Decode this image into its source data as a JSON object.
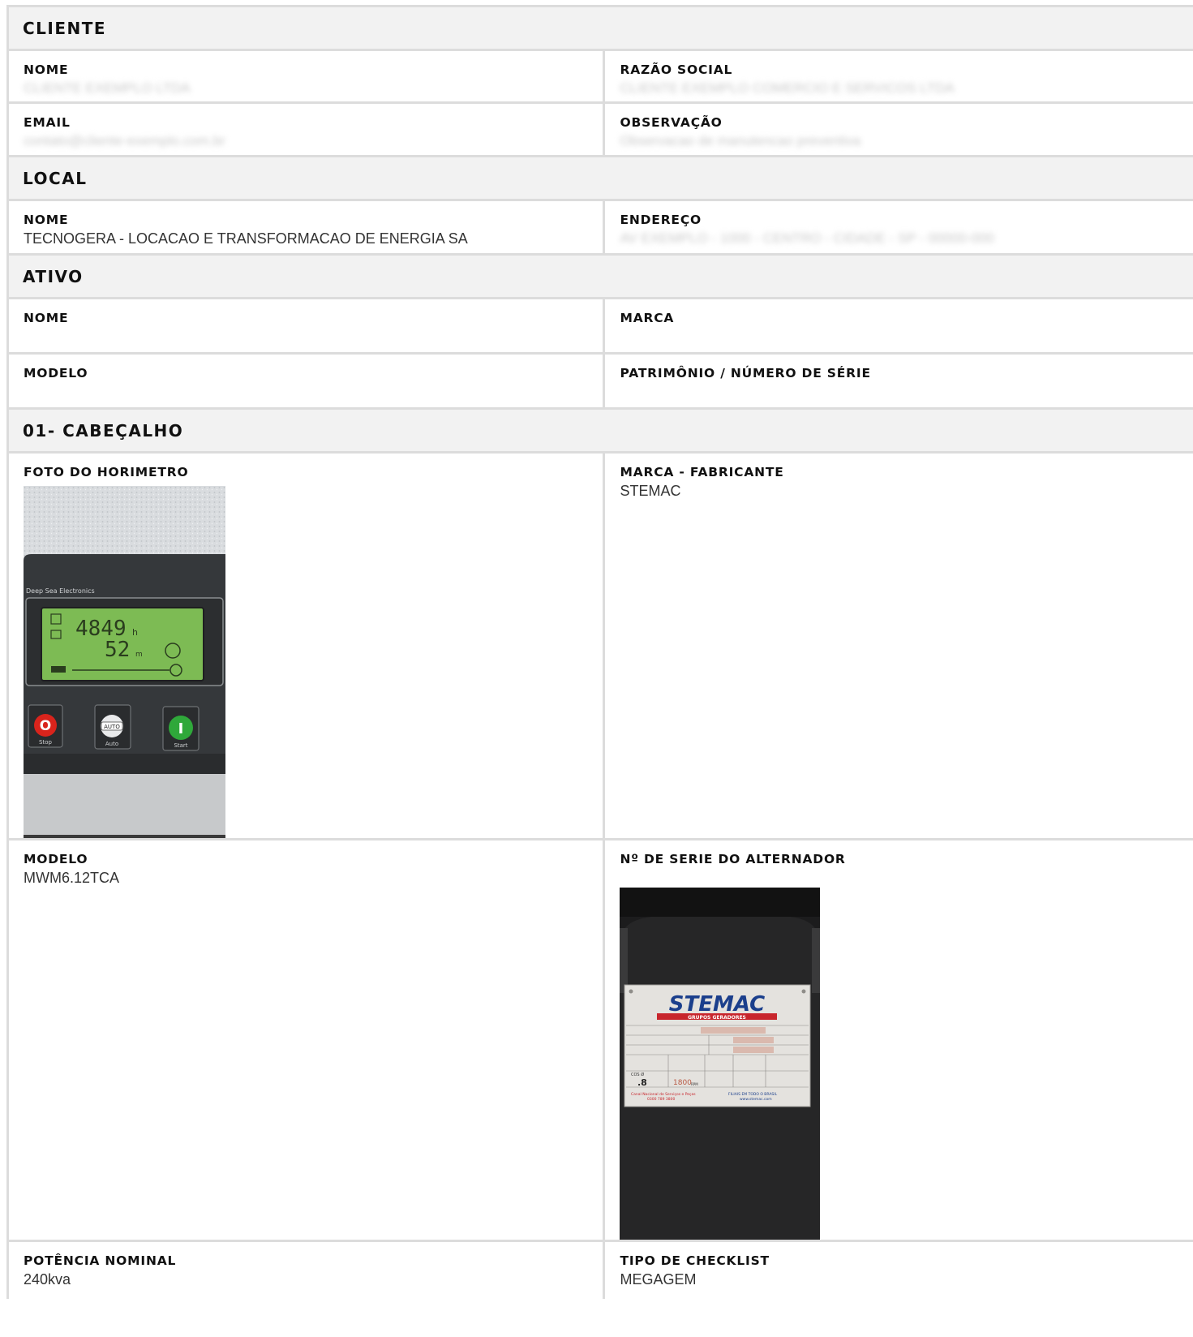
{
  "cliente": {
    "title": "CLIENTE",
    "nome_label": "NOME",
    "nome_value": "CLIENTE EXEMPLO LTDA",
    "razao_label": "RAZÃO SOCIAL",
    "razao_value": "CLIENTE EXEMPLO COMERCIO E SERVICOS LTDA",
    "email_label": "EMAIL",
    "email_value": "contato@cliente-exemplo.com.br",
    "obs_label": "OBSERVAÇÃO",
    "obs_value": "Observacao de manutencao preventiva"
  },
  "local": {
    "title": "LOCAL",
    "nome_label": "NOME",
    "nome_value": "TECNOGERA - LOCACAO E TRANSFORMACAO DE ENERGIA SA",
    "endereco_label": "ENDEREÇO",
    "endereco_value": "AV EXEMPLO - 1000 - CENTRO - CIDADE - SP - 00000-000"
  },
  "ativo": {
    "title": "ATIVO",
    "nome_label": "NOME",
    "marca_label": "MARCA",
    "modelo_label": "MODELO",
    "patrimonio_label": "PATRIMÔNIO / NÚMERO DE SÉRIE"
  },
  "cabecalho": {
    "title": "01- CABEÇALHO",
    "foto_label": "FOTO DO HORIMETRO",
    "marca_label": "MARCA - FABRICANTE",
    "marca_value": "STEMAC",
    "modelo_label": "MODELO",
    "modelo_value": "MWM6.12TCA",
    "serie_label": "Nº DE SERIE DO ALTERNADOR",
    "potencia_label": "POTÊNCIA NOMINAL",
    "potencia_value": "240kva",
    "tipo_label": "TIPO DE CHECKLIST",
    "tipo_value": "MEGAGEM"
  },
  "horimetro": {
    "brand": "Deep Sea Electronics",
    "hours": "4849",
    "hours_unit": "h",
    "minutes": "52",
    "minutes_unit": "m",
    "stop": "Stop",
    "auto": "Auto",
    "auto_badge": "AUTO",
    "start": "Start",
    "stop_symbol": "O",
    "start_symbol": "I"
  },
  "placa": {
    "brand": "STEMAC",
    "subtitle": "GRUPOS GERADORES",
    "cos_label": "COS Ø",
    "cos_value": ".8",
    "rotacao": "1800",
    "rpm": "RPM",
    "footer_left": "Canal Nacional de Serviços e Peças",
    "footer_left2": "0300 789 3800",
    "footer_right": "FILIAIS EM TODO O BRASIL",
    "footer_right2": "www.stemac.com"
  },
  "colors": {
    "border": "#dcdcdc",
    "header_bg": "#f2f2f2",
    "lcd": "#7dbb54",
    "stop_red": "#d9241c",
    "start_green": "#2fa83a",
    "stemac_blue": "#1b3f8c",
    "stemac_red": "#c8252c"
  }
}
